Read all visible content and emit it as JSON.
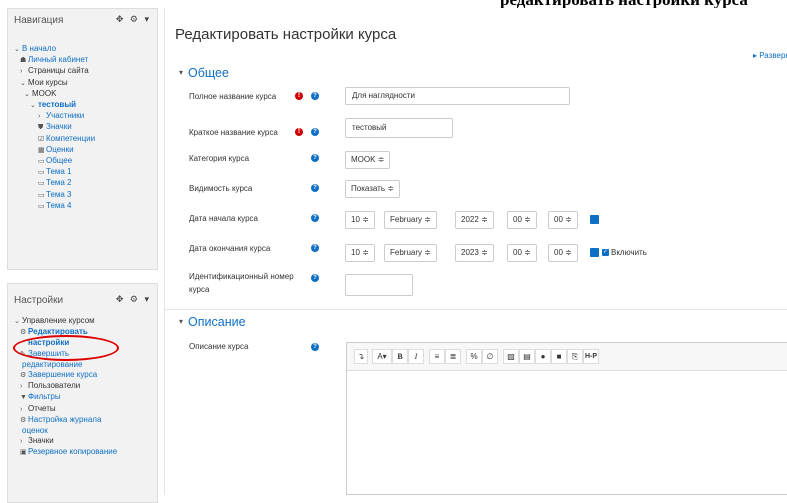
{
  "top_caption": "редактировать настройки курса",
  "navigation": {
    "title": "Навигация",
    "tools": "✥ ⚙ ▾",
    "items": [
      {
        "label": "В начало",
        "prefix": "⌄",
        "style": "lnk"
      },
      {
        "label": "Личный кабинет",
        "prefix": "☗",
        "style": "lnk"
      },
      {
        "label": "Страницы сайта",
        "prefix": "›",
        "style": "muted"
      },
      {
        "label": "Мои курсы",
        "prefix": "⌄",
        "style": "muted"
      },
      {
        "label": "MOOK",
        "prefix": "⌄",
        "style": "muted"
      },
      {
        "label": "тестовый",
        "prefix": "⌄",
        "style": "lnk bold"
      },
      {
        "label": "Участники",
        "prefix": "›",
        "style": "lnk"
      },
      {
        "label": "Значки",
        "prefix": "⛊",
        "style": "lnk"
      },
      {
        "label": "Компетенции",
        "prefix": "☑",
        "style": "lnk"
      },
      {
        "label": "Оценки",
        "prefix": "▦",
        "style": "lnk"
      },
      {
        "label": "Общее",
        "prefix": "▭",
        "style": "lnk"
      },
      {
        "label": "Тема 1",
        "prefix": "▭",
        "style": "lnk"
      },
      {
        "label": "Тема 2",
        "prefix": "▭",
        "style": "lnk"
      },
      {
        "label": "Тема 3",
        "prefix": "▭",
        "style": "lnk"
      },
      {
        "label": "Тема 4",
        "prefix": "▭",
        "style": "lnk"
      }
    ]
  },
  "settings": {
    "title": "Настройки",
    "tools": "✥ ⚙ ▾",
    "items": [
      {
        "label": "Управление курсом",
        "prefix": "⌄",
        "style": "muted"
      },
      {
        "label": "Редактировать",
        "prefix": "⚙",
        "style": "lnk bold"
      },
      {
        "label": "настройки",
        "prefix": "",
        "style": "lnk bold"
      },
      {
        "label": "Завершить",
        "prefix": "✎",
        "style": "lnk"
      },
      {
        "label": "редактирование",
        "prefix": "",
        "style": "lnk"
      },
      {
        "label": "Завершение курса",
        "prefix": "⚙",
        "style": "lnk"
      },
      {
        "label": "Пользователи",
        "prefix": "›",
        "style": "muted"
      },
      {
        "label": "Фильтры",
        "prefix": "▼",
        "style": "lnk"
      },
      {
        "label": "Отчеты",
        "prefix": "›",
        "style": "muted"
      },
      {
        "label": "Настройка журнала",
        "prefix": "⚙",
        "style": "lnk"
      },
      {
        "label": "оценок",
        "prefix": "",
        "style": "lnk"
      },
      {
        "label": "Значки",
        "prefix": "›",
        "style": "muted"
      },
      {
        "label": "Резервное копирование",
        "prefix": "▣",
        "style": "lnk"
      }
    ]
  },
  "main": {
    "page_title": "Редактировать настройки курса",
    "expand_all": "▸ Развернуть все",
    "general_section": "Общее",
    "fields": {
      "fullname_label": "Полное название курса",
      "fullname_value": "Для наглядности",
      "shortname_label": "Краткое название курса",
      "shortname_value": "тестовый",
      "category_label": "Категория курса",
      "category_value": "MOOK ≑",
      "visibility_label": "Видимость курса",
      "visibility_value": "Показать ≑",
      "start_label": "Дата начала курса",
      "end_label": "Дата окончания курса",
      "idnumber_label_1": "Идентификационный номер",
      "idnumber_label_2": "курса",
      "enable_label": "Включить"
    },
    "start_date": {
      "day": "10 ≑",
      "month": "February  ≑",
      "year": "2022 ≑",
      "hour": "00 ≑",
      "minute": "00 ≑"
    },
    "end_date": {
      "day": "10 ≑",
      "month": "February  ≑",
      "year": "2023 ≑",
      "hour": "00 ≑",
      "minute": "00 ≑"
    },
    "description_section": "Описание",
    "description_label": "Описание курса"
  },
  "colors": {
    "link": "#0f6fc5",
    "required": "#cc0000",
    "highlight": "#dd0000"
  }
}
